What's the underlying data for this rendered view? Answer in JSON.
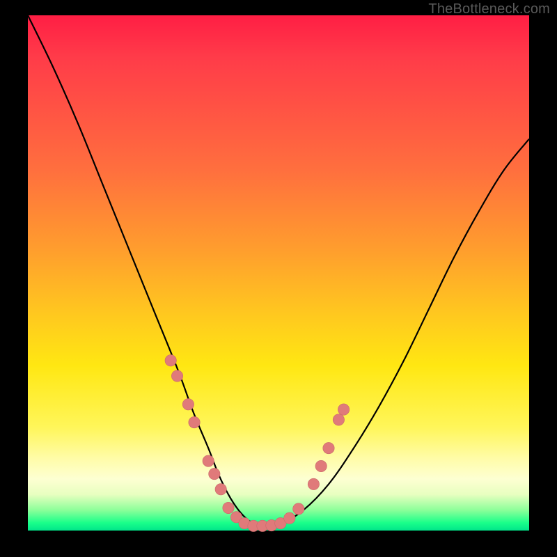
{
  "attribution": "TheBottleneck.com",
  "colors": {
    "background": "#000000",
    "gradient_top": "#ff1e44",
    "gradient_mid": "#ffe712",
    "gradient_bottom": "#00e58a",
    "curve": "#000000",
    "dots": "#e07a7a"
  },
  "chart_data": {
    "type": "line",
    "title": "",
    "xlabel": "",
    "ylabel": "",
    "xlim": [
      0,
      100
    ],
    "ylim": [
      0,
      100
    ],
    "grid": false,
    "note": "Axes are not labeled in the image; x and y are expressed as percentages of the plot area (0–100). y measures vertical position from the bottom (0) to the top (100). Values were read off the rendered curve and marker positions.",
    "series": [
      {
        "name": "curve",
        "x": [
          0,
          5,
          10,
          15,
          20,
          25,
          30,
          33,
          36,
          38,
          40,
          42,
          44,
          46,
          48,
          50,
          55,
          60,
          65,
          70,
          75,
          80,
          85,
          90,
          95,
          100
        ],
        "y": [
          100,
          90,
          79,
          67,
          55,
          43,
          31,
          23,
          16,
          11,
          7,
          4,
          2,
          1,
          1,
          1,
          4,
          9,
          16,
          24,
          33,
          43,
          53,
          62,
          70,
          76
        ]
      }
    ],
    "markers": [
      {
        "x": 28.5,
        "y": 33.0
      },
      {
        "x": 29.8,
        "y": 30.0
      },
      {
        "x": 32.0,
        "y": 24.5
      },
      {
        "x": 33.2,
        "y": 21.0
      },
      {
        "x": 36.0,
        "y": 13.5
      },
      {
        "x": 37.2,
        "y": 11.0
      },
      {
        "x": 38.5,
        "y": 8.0
      },
      {
        "x": 40.0,
        "y": 4.4
      },
      {
        "x": 41.6,
        "y": 2.6
      },
      {
        "x": 43.2,
        "y": 1.4
      },
      {
        "x": 45.0,
        "y": 0.9
      },
      {
        "x": 46.8,
        "y": 0.9
      },
      {
        "x": 48.6,
        "y": 1.0
      },
      {
        "x": 50.4,
        "y": 1.4
      },
      {
        "x": 52.2,
        "y": 2.4
      },
      {
        "x": 54.0,
        "y": 4.2
      },
      {
        "x": 57.0,
        "y": 9.0
      },
      {
        "x": 58.5,
        "y": 12.5
      },
      {
        "x": 60.0,
        "y": 16.0
      },
      {
        "x": 62.0,
        "y": 21.5
      },
      {
        "x": 63.0,
        "y": 23.5
      }
    ]
  }
}
